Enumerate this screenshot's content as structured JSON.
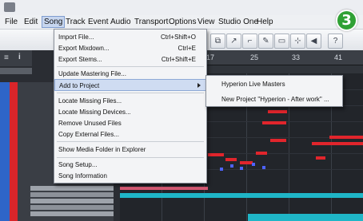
{
  "menubar": {
    "items": [
      "File",
      "Edit",
      "Song",
      "Track",
      "Event",
      "Audio",
      "Transport",
      "Options",
      "View",
      "Studio One",
      "Help"
    ],
    "active": "Song"
  },
  "badge": {
    "label": "3",
    "color": "#30a135"
  },
  "ruler": {
    "bars": [
      "17",
      "25",
      "33",
      "41"
    ]
  },
  "song_menu": {
    "items": [
      {
        "label": "Import File...",
        "shortcut": "Ctrl+Shift+O"
      },
      {
        "label": "Export Mixdown...",
        "shortcut": "Ctrl+E"
      },
      {
        "label": "Export Stems...",
        "shortcut": "Ctrl+Shift+E"
      },
      {
        "label": "Update Mastering File...",
        "shortcut": ""
      },
      {
        "label": "Add to Project",
        "shortcut": "",
        "submenu": true,
        "highlighted": true
      },
      {
        "label": "Locate Missing Files...",
        "shortcut": ""
      },
      {
        "label": "Locate Missing Devices...",
        "shortcut": ""
      },
      {
        "label": "Remove Unused Files",
        "shortcut": ""
      },
      {
        "label": "Copy External Files...",
        "shortcut": ""
      },
      {
        "label": "Show Media Folder in Explorer",
        "shortcut": ""
      },
      {
        "label": "Song Setup...",
        "shortcut": ""
      },
      {
        "label": "Song Information",
        "shortcut": ""
      }
    ]
  },
  "submenu": {
    "items": [
      "Hyperion Live Masters",
      "New Project \"Hyperion - After work\" ..."
    ]
  },
  "colors": {
    "accent": "#30a135",
    "note": "#e1252c",
    "highlight": "#cfdcf2",
    "track_cyan": "#1fb6c7"
  }
}
